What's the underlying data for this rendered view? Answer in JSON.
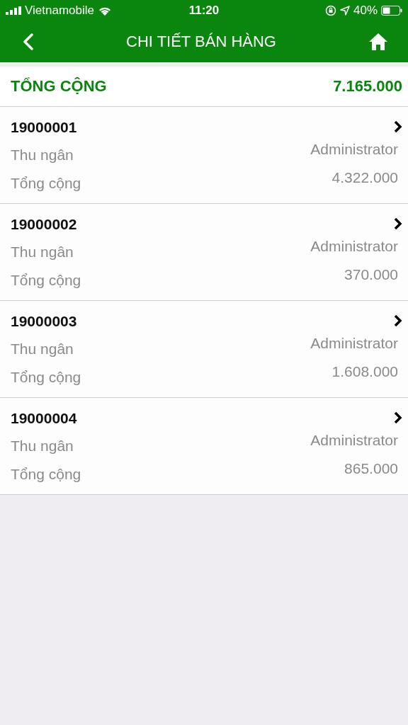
{
  "status_bar": {
    "carrier": "Vietnamobile",
    "time": "11:20",
    "battery": "40%"
  },
  "nav": {
    "title": "CHI TIẾT BÁN HÀNG"
  },
  "summary": {
    "label": "TỔNG CỘNG",
    "value": "7.165.000"
  },
  "orders": [
    {
      "number": "19000001",
      "cashier_label": "Thu ngân",
      "cashier": "Administrator",
      "total_label": "Tổng cộng",
      "total": "4.322.000"
    },
    {
      "number": "19000002",
      "cashier_label": "Thu ngân",
      "cashier": "Administrator",
      "total_label": "Tổng cộng",
      "total": "370.000"
    },
    {
      "number": "19000003",
      "cashier_label": "Thu ngân",
      "cashier": "Administrator",
      "total_label": "Tổng cộng",
      "total": "1.608.000"
    },
    {
      "number": "19000004",
      "cashier_label": "Thu ngân",
      "cashier": "Administrator",
      "total_label": "Tổng cộng",
      "total": "865.000"
    }
  ]
}
